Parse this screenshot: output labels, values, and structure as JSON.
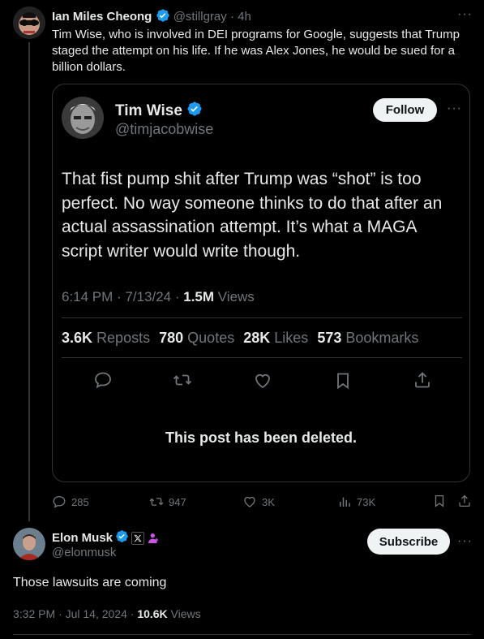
{
  "outer_post": {
    "author_name": "Ian Miles Cheong",
    "handle": "@stillgray",
    "separator": "·",
    "time": "4h",
    "more": "···",
    "text_line1": "Tim Wise, who is involved in DEI programs for Google, suggests that Trump",
    "text_line2": "staged the attempt on his life. If he was Alex Jones, he would be sued for a",
    "text_line3": "billion dollars.",
    "actions": {
      "replies": "285",
      "reposts": "947",
      "likes": "3K",
      "views": "73K"
    }
  },
  "quoted_post": {
    "author_name": "Tim Wise",
    "handle": "@timjacobwise",
    "follow_label": "Follow",
    "more": "···",
    "text_line1": "That fist pump shit after Trump was “shot” is too",
    "text_line2": "perfect. No way someone thinks to do that after an",
    "text_line3": "actual assassination attempt. It’s what a MAGA",
    "text_line4": "script writer would write though.",
    "meta_time": "6:14 PM · 7/13/24 · ",
    "meta_views_count": "1.5M",
    "meta_views_label": " Views",
    "stats": {
      "reposts_count": "3.6K",
      "reposts_label": "Reposts",
      "quotes_count": "780",
      "quotes_label": "Quotes",
      "likes_count": "28K",
      "likes_label": "Likes",
      "bookmarks_count": "573",
      "bookmarks_label": "Bookmarks"
    },
    "deleted_notice": "This post has been deleted."
  },
  "reply_post": {
    "author_name": "Elon Musk",
    "handle": "@elonmusk",
    "subscribe_label": "Subscribe",
    "more": "···",
    "text": "Those lawsuits are coming",
    "meta_time": "3:32 PM · Jul 14, 2024 · ",
    "meta_views_count": "10.6K",
    "meta_views_label": " Views"
  },
  "colors": {
    "background": "#000000",
    "text": "#e7e9ea",
    "muted": "#71767b",
    "verified_blue": "#1d9bf0",
    "border": "#2f3336",
    "button_bg": "#eff3f4"
  }
}
